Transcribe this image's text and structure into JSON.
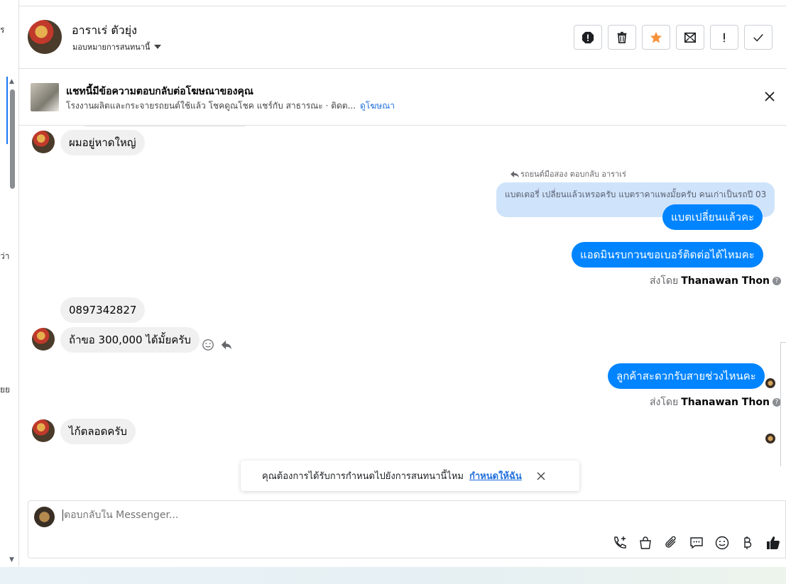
{
  "sidebar": {
    "fragments": [
      "ร",
      "ว่า",
      "ยย"
    ]
  },
  "header": {
    "contact_name": "อาราเร่ ตัวยุ่ง",
    "assign_label": "มอบหมายการสนทนานี้",
    "actions": [
      {
        "name": "spam-icon"
      },
      {
        "name": "trash-icon"
      },
      {
        "name": "star-icon"
      },
      {
        "name": "mark-unread-icon"
      },
      {
        "name": "follow-up-icon"
      },
      {
        "name": "done-check-icon"
      }
    ],
    "star_color": "#f7923b"
  },
  "ad_banner": {
    "title": "แชทนี้มีข้อความตอบกลับต่อโฆษณาของคุณ",
    "subtitle": "โรงงานผลิตและกระจายรถยนต์ใช้แล้ว โชคดูณโชค แชร์กับ สาธารณะ · ติดต...",
    "link": "ดูโฆษณา"
  },
  "messages": {
    "m1": "ผมอยู่หาดใหญ่",
    "reply_label": "รถยนต์มือสอง ตอบกลับ อาราเร่",
    "quoted": "แบตเตอรี่ เปลี่ยนแล้วเหรอครับ แบตราคาแพงมั้ยครับ คนเก่าเป็นรถปี 03",
    "m2": "แบตเปลี่ยนแล้วคะ",
    "m3": "แอดมินรบกวนขอเบอร์ติดต่อได้ไหมคะ",
    "sent_by_prefix": "ส่งโดย",
    "sent_by_name": "Thanawan Thon",
    "m4": "0897342827",
    "m5": "ถ้าขอ 300,000 ได้มั้ยครับ",
    "m6": "ลูกค้าสะดวกรับสายช่วงไหนคะ",
    "m7": "ไก้ตลอดครับ"
  },
  "toast": {
    "text": "คุณต้องการได้รับการกำหนดไปยังการสนทนานี้ไหม",
    "link": "กำหนดให้ฉัน"
  },
  "composer": {
    "placeholder": "ตอบกลับใน Messenger...",
    "tools": [
      "call-add-icon",
      "shopping-bag-icon",
      "attachment-icon",
      "saved-reply-icon",
      "emoji-icon",
      "baht-icon",
      "like-icon"
    ]
  },
  "colors": {
    "accent": "#0084ff",
    "link": "#216fdb",
    "incoming_bubble": "#f0f0f0",
    "quoted_bubble": "#cfe3fb"
  }
}
